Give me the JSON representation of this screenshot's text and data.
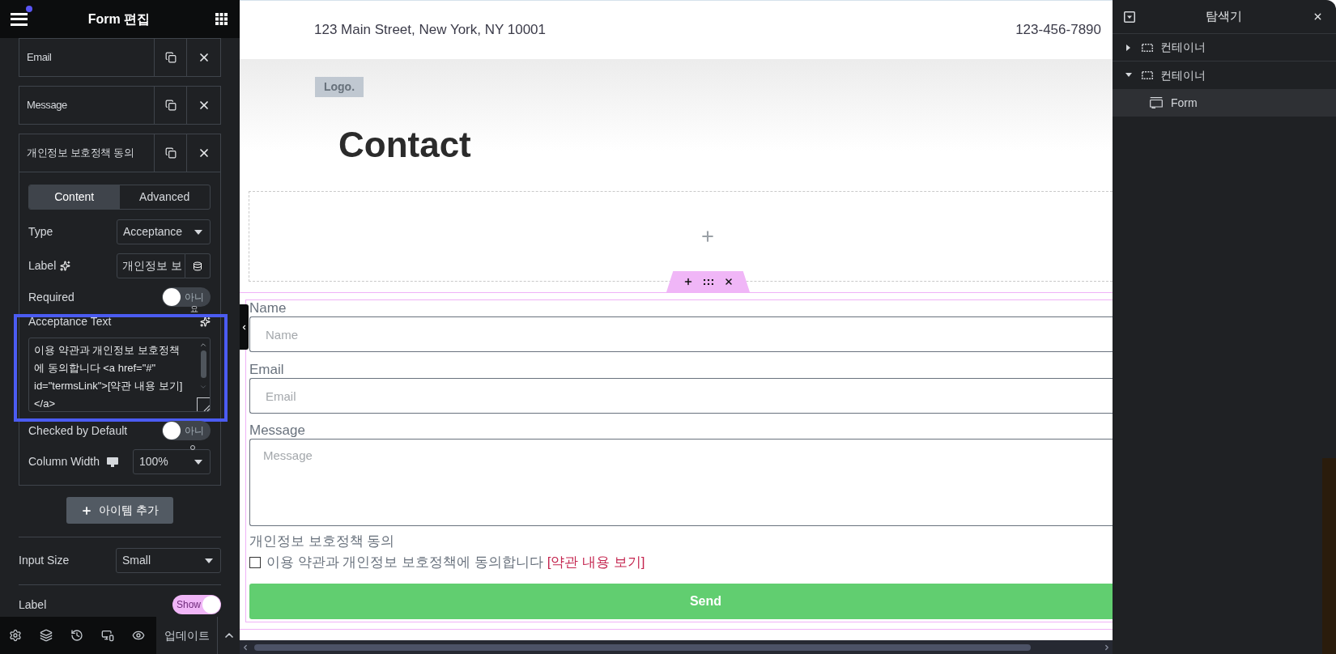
{
  "editor_panel": {
    "title": "Form 편집",
    "menu_notification": true,
    "form_items": [
      {
        "label": "Email",
        "expanded": false
      },
      {
        "label": "Message",
        "expanded": false
      },
      {
        "label": "개인정보 보호정책 동의",
        "expanded": true,
        "settings": {
          "tabs": [
            {
              "label": "Content",
              "selected": true
            },
            {
              "label": "Advanced",
              "selected": false
            }
          ],
          "type": {
            "label": "Type",
            "value": "Acceptance"
          },
          "label_field": {
            "label": "Label",
            "value": "개인정보 보"
          },
          "required": {
            "label": "Required",
            "on": false,
            "state_text": "아니"
          },
          "acceptance_text": {
            "label": "Acceptance Text",
            "tooltip_fragment": "요",
            "value": "이용 약관과 개인정보 보호정책에 동의합니다 <a href=\"#\" id=\"termsLink\">[약관 내용 보기]</a>",
            "highlighted": true
          },
          "checked_by_default": {
            "label": "Checked by Default",
            "on": false,
            "state_text": "아니"
          },
          "column_width": {
            "label": "Column Width",
            "value": "100%"
          }
        }
      }
    ],
    "add_item_button": "아이템 추가",
    "input_size": {
      "label": "Input Size",
      "value": "Small"
    },
    "label_toggle": {
      "label": "Label",
      "on": true,
      "state_text": "Show"
    }
  },
  "bottom_bar": {
    "update_button": "업데이트"
  },
  "page": {
    "top_bar": {
      "address": "123 Main Street, New York, NY 10001",
      "phone": "123-456-7890"
    },
    "logo": "Logo.",
    "heading": "Contact",
    "form": {
      "fields": [
        {
          "kind": "input",
          "label": "Name",
          "placeholder": "Name"
        },
        {
          "kind": "input",
          "label": "Email",
          "placeholder": "Email"
        },
        {
          "kind": "textarea",
          "label": "Message",
          "placeholder": "Message"
        },
        {
          "kind": "acceptance",
          "label": "개인정보 보호정책 동의",
          "text": "이용 약관과 개인정보 보호정책에 동의합니다",
          "link": "[약관 내용 보기]",
          "checked": false
        }
      ],
      "submit_button": "Send"
    }
  },
  "navigator": {
    "title": "탐색기",
    "items": [
      {
        "label": "컨테이너",
        "kind": "container",
        "expanded": false,
        "selected": false
      },
      {
        "label": "컨테이너",
        "kind": "container",
        "expanded": true,
        "selected": false,
        "children": [
          {
            "label": "Form",
            "kind": "widget",
            "selected": true
          }
        ]
      }
    ]
  }
}
